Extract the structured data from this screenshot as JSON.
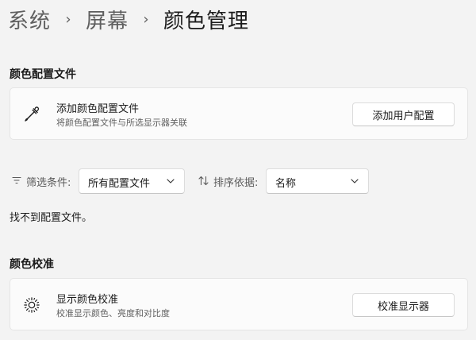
{
  "breadcrumb": {
    "items": [
      "系统",
      "屏幕",
      "颜色管理"
    ],
    "separator": "›"
  },
  "profiles_section": {
    "title": "颜色配置文件",
    "add_card": {
      "icon": "eyedropper-icon",
      "title": "添加颜色配置文件",
      "description": "将颜色配置文件与所选显示器关联",
      "button_label": "添加用户配置"
    },
    "filter": {
      "icon": "filter-icon",
      "label": "筛选条件:",
      "selected": "所有配置文件"
    },
    "sort": {
      "icon": "sort-icon",
      "label": "排序依据:",
      "selected": "名称"
    },
    "empty_message": "找不到配置文件。"
  },
  "calibration_section": {
    "title": "颜色校准",
    "card": {
      "icon": "brightness-icon",
      "title": "显示颜色校准",
      "description": "校准显示颜色、亮度和对比度",
      "button_label": "校准显示器"
    }
  },
  "colors": {
    "background": "#f3f3f3",
    "card": "#fbfbfb",
    "text_primary": "#1b1b1b",
    "text_secondary": "#616161"
  }
}
